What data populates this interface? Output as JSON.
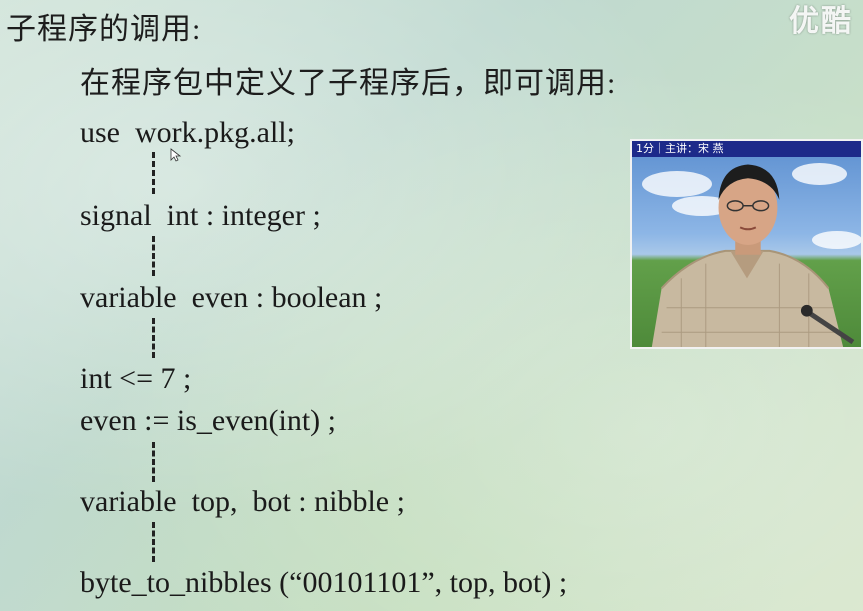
{
  "watermark": "优酷",
  "slide": {
    "heading": "子程序的调用:",
    "subheading": "在程序包中定义了子程序后，即可调用:",
    "code_lines": [
      "use  work.pkg.all;",
      "signal  int : integer ;",
      "variable  even : boolean ;",
      "int <= 7 ;",
      "even := is_even(int) ;",
      "variable  top,  bot : nibble ;",
      "byte_to_nibbles (“00101101”, top, bot) ;"
    ]
  },
  "video": {
    "caption": "1分｜主讲：宋 燕"
  }
}
